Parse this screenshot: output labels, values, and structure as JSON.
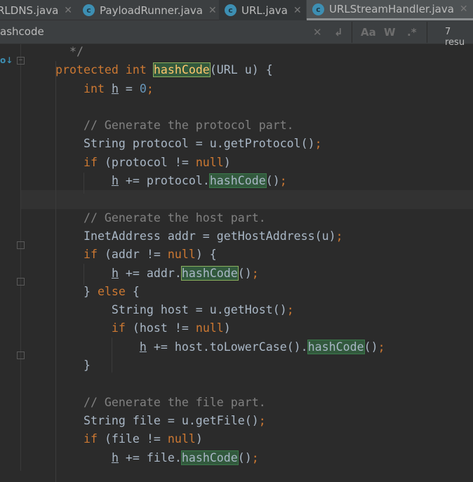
{
  "tabs": [
    {
      "label": "RLDNS.java",
      "icon": "java-class-icon",
      "state": "normal"
    },
    {
      "label": "PayloadRunner.java",
      "icon": "java-class-icon",
      "state": "normal"
    },
    {
      "label": "URL.java",
      "icon": "java-class-locked-icon",
      "state": "dim"
    },
    {
      "label": "URLStreamHandler.java",
      "icon": "java-class-locked-icon",
      "state": "active"
    }
  ],
  "search": {
    "query": "ashcode",
    "match_case": "Aa",
    "words": "W",
    "regex": ".*",
    "results": "7 resu"
  },
  "colors": {
    "background": "#2b2b2b",
    "keyword": "#cc7832",
    "match_highlight": "#32593d"
  },
  "code": [
    [
      [
        "cm",
        "  */"
      ]
    ],
    [
      [
        "kw",
        "protected int "
      ],
      [
        "hl sel",
        "hashCode"
      ],
      [
        "",
        "(URL u) {"
      ]
    ],
    [
      [
        "",
        "    "
      ],
      [
        "kw",
        "int "
      ],
      [
        "u",
        "h"
      ],
      [
        "",
        " = "
      ],
      [
        "num",
        "0"
      ],
      [
        "kw",
        ";"
      ]
    ],
    [],
    [
      [
        "cm",
        "    // Generate the protocol part."
      ]
    ],
    [
      [
        "",
        "    String protocol = u.getProtocol()"
      ],
      [
        "kw",
        ";"
      ]
    ],
    [
      [
        "kw",
        "    if "
      ],
      [
        "",
        "(protocol != "
      ],
      [
        "kw",
        "null"
      ],
      [
        "",
        ")"
      ]
    ],
    [
      [
        "",
        "        "
      ],
      [
        "u",
        "h"
      ],
      [
        "",
        " += protocol."
      ],
      [
        "hl",
        "hashCode"
      ],
      [
        "",
        "()"
      ],
      [
        "kw",
        ";"
      ]
    ],
    [],
    [
      [
        "cm",
        "    // Generate the host part."
      ]
    ],
    [
      [
        "",
        "    InetAddress addr = getHostAddress(u)"
      ],
      [
        "kw",
        ";"
      ]
    ],
    [
      [
        "kw",
        "    if "
      ],
      [
        "",
        "(addr != "
      ],
      [
        "kw",
        "null"
      ],
      [
        "",
        ") {"
      ]
    ],
    [
      [
        "",
        "        "
      ],
      [
        "u",
        "h"
      ],
      [
        "",
        " += addr."
      ],
      [
        "hl sel2",
        "hashCode"
      ],
      [
        "",
        "()"
      ],
      [
        "kw",
        ";"
      ]
    ],
    [
      [
        "",
        "    } "
      ],
      [
        "kw",
        "else "
      ],
      [
        "",
        "{"
      ]
    ],
    [
      [
        "",
        "        String host = u.getHost()"
      ],
      [
        "kw",
        ";"
      ]
    ],
    [
      [
        "kw",
        "        if "
      ],
      [
        "",
        "(host != "
      ],
      [
        "kw",
        "null"
      ],
      [
        "",
        ")"
      ]
    ],
    [
      [
        "",
        "            "
      ],
      [
        "u",
        "h"
      ],
      [
        "",
        " += host.toLowerCase()."
      ],
      [
        "hl",
        "hashCode"
      ],
      [
        "",
        "()"
      ],
      [
        "kw",
        ";"
      ]
    ],
    [
      [
        "",
        "    }"
      ]
    ],
    [],
    [
      [
        "cm",
        "    // Generate the file part."
      ]
    ],
    [
      [
        "",
        "    String file = u.getFile()"
      ],
      [
        "kw",
        ";"
      ]
    ],
    [
      [
        "kw",
        "    if "
      ],
      [
        "",
        "(file != "
      ],
      [
        "kw",
        "null"
      ],
      [
        "",
        ")"
      ]
    ],
    [
      [
        "",
        "        "
      ],
      [
        "u",
        "h"
      ],
      [
        "",
        " += file."
      ],
      [
        "hl",
        "hashCode"
      ],
      [
        "",
        "()"
      ],
      [
        "kw",
        ";"
      ]
    ]
  ]
}
